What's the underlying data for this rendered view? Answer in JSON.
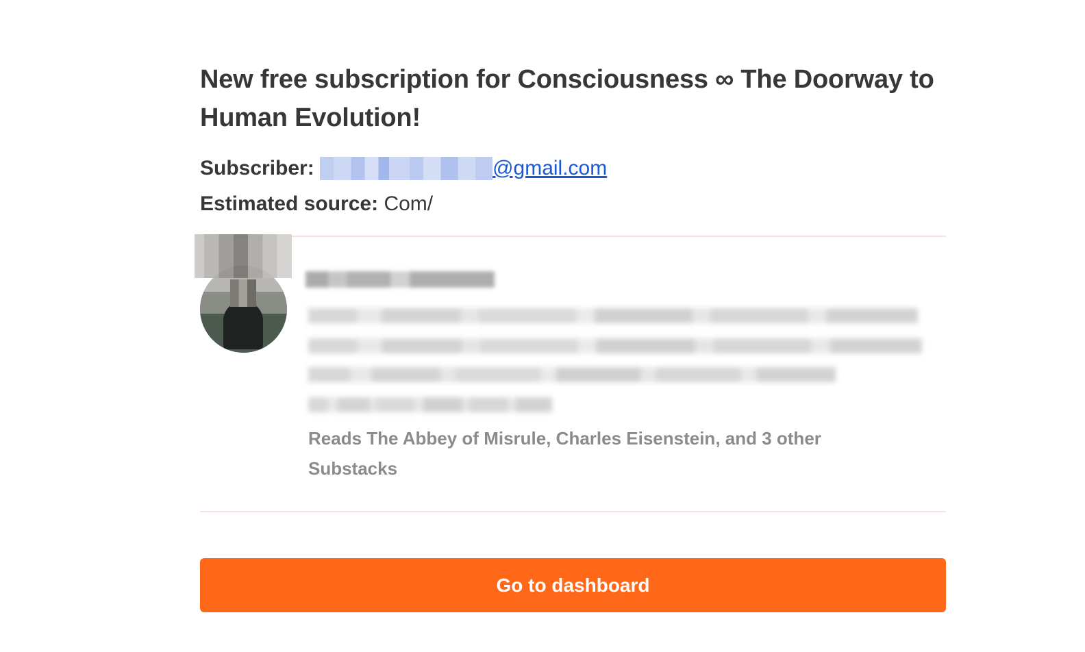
{
  "email": {
    "title": "New free subscription for Consciousness ∞ The Doorway to Human Evolution!",
    "subscriber_label": "Subscriber:",
    "subscriber_email_visible": "@gmail.com",
    "source_label": "Estimated source:",
    "source_value": "Com/",
    "reads_text": "Reads The Abbey of Misrule, Charles Eisenstein, and 3 other Substacks",
    "cta_label": "Go to dashboard"
  },
  "colors": {
    "accent": "#ff6719",
    "link": "#1a58d6",
    "text": "#363737",
    "muted": "#8b8b8b",
    "divider": "#f7e2db"
  }
}
